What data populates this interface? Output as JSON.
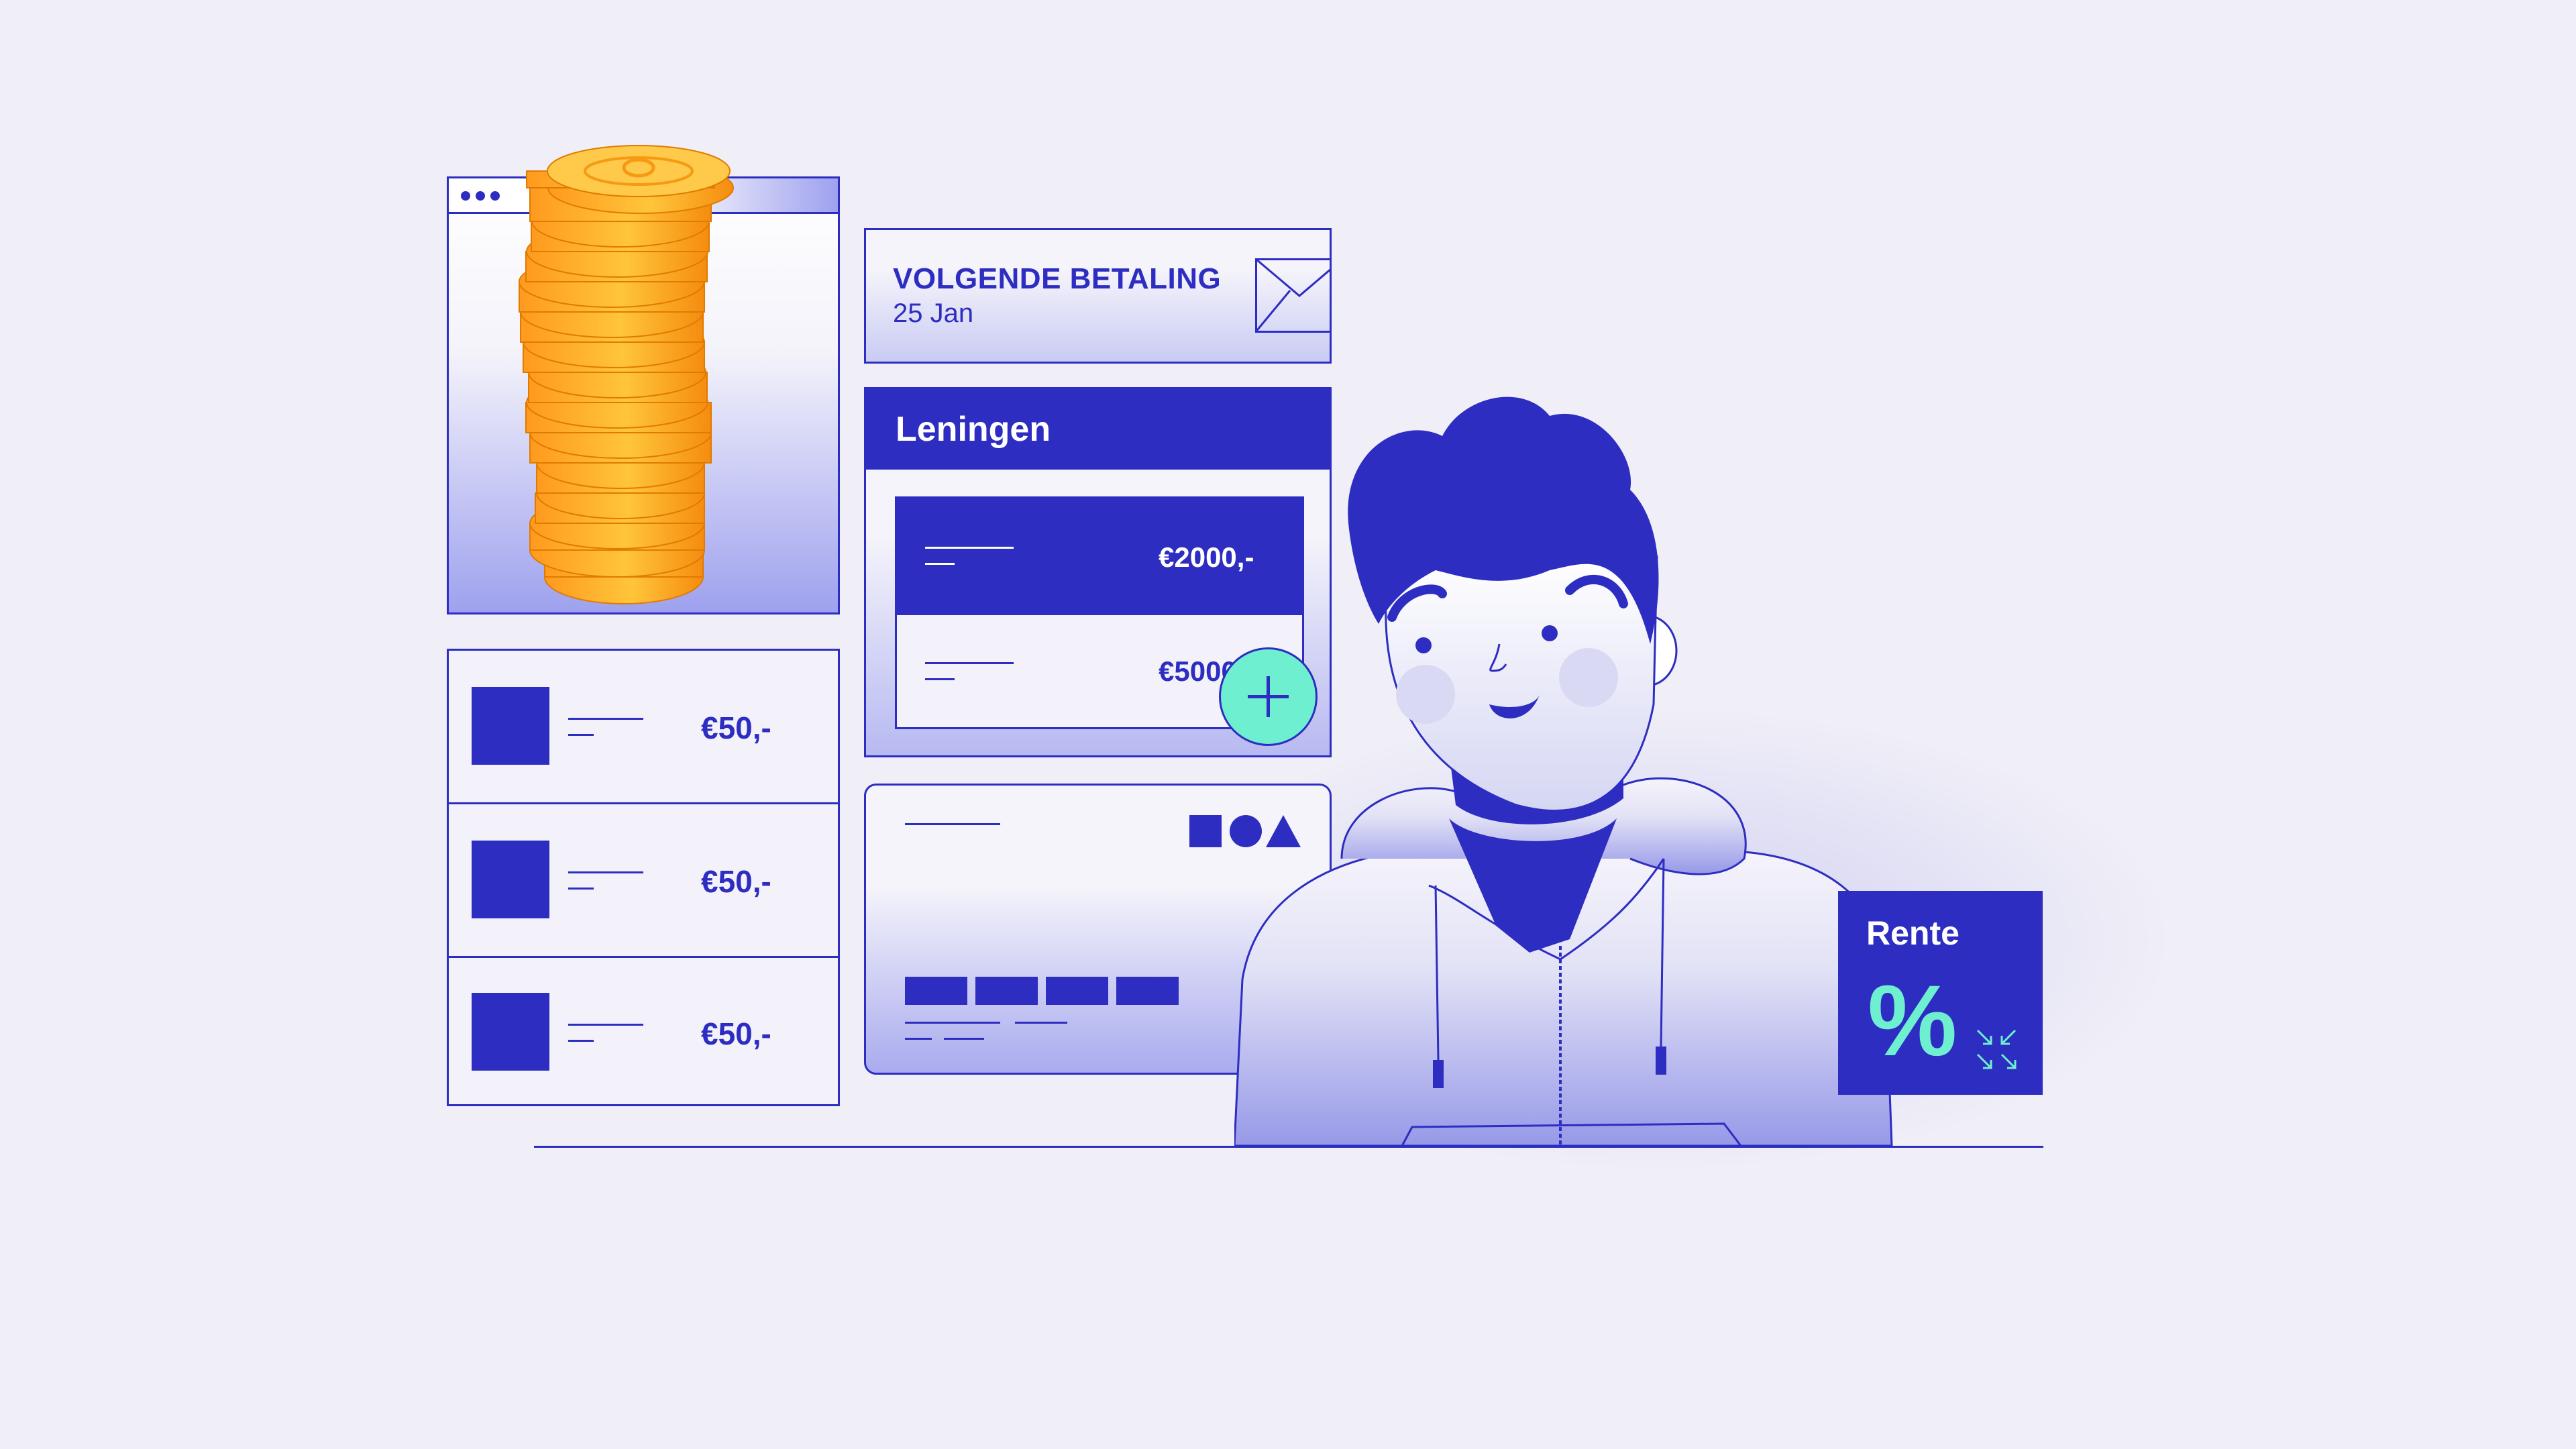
{
  "next_payment": {
    "title": "VOLGENDE BETALING",
    "date": "25 Jan"
  },
  "loans": {
    "title": "Leningen",
    "items": [
      {
        "amount": "€2000,-"
      },
      {
        "amount": "€5000"
      }
    ]
  },
  "payments": [
    {
      "amount": "€50,-"
    },
    {
      "amount": "€50,-"
    },
    {
      "amount": "€50,-"
    }
  ],
  "rente": {
    "title": "Rente",
    "symbol": "%"
  },
  "icons": {
    "add": "plus-icon",
    "mail": "envelope-icon",
    "shapes": "square-circle-triangle-icon",
    "arrows": "shrink-arrows-icon",
    "coins": "coin-stack-icon"
  },
  "colors": {
    "primary": "#2d2dc1",
    "accent": "#6ef0d0",
    "coin": "#f7a823",
    "background": "#f0eff7"
  }
}
